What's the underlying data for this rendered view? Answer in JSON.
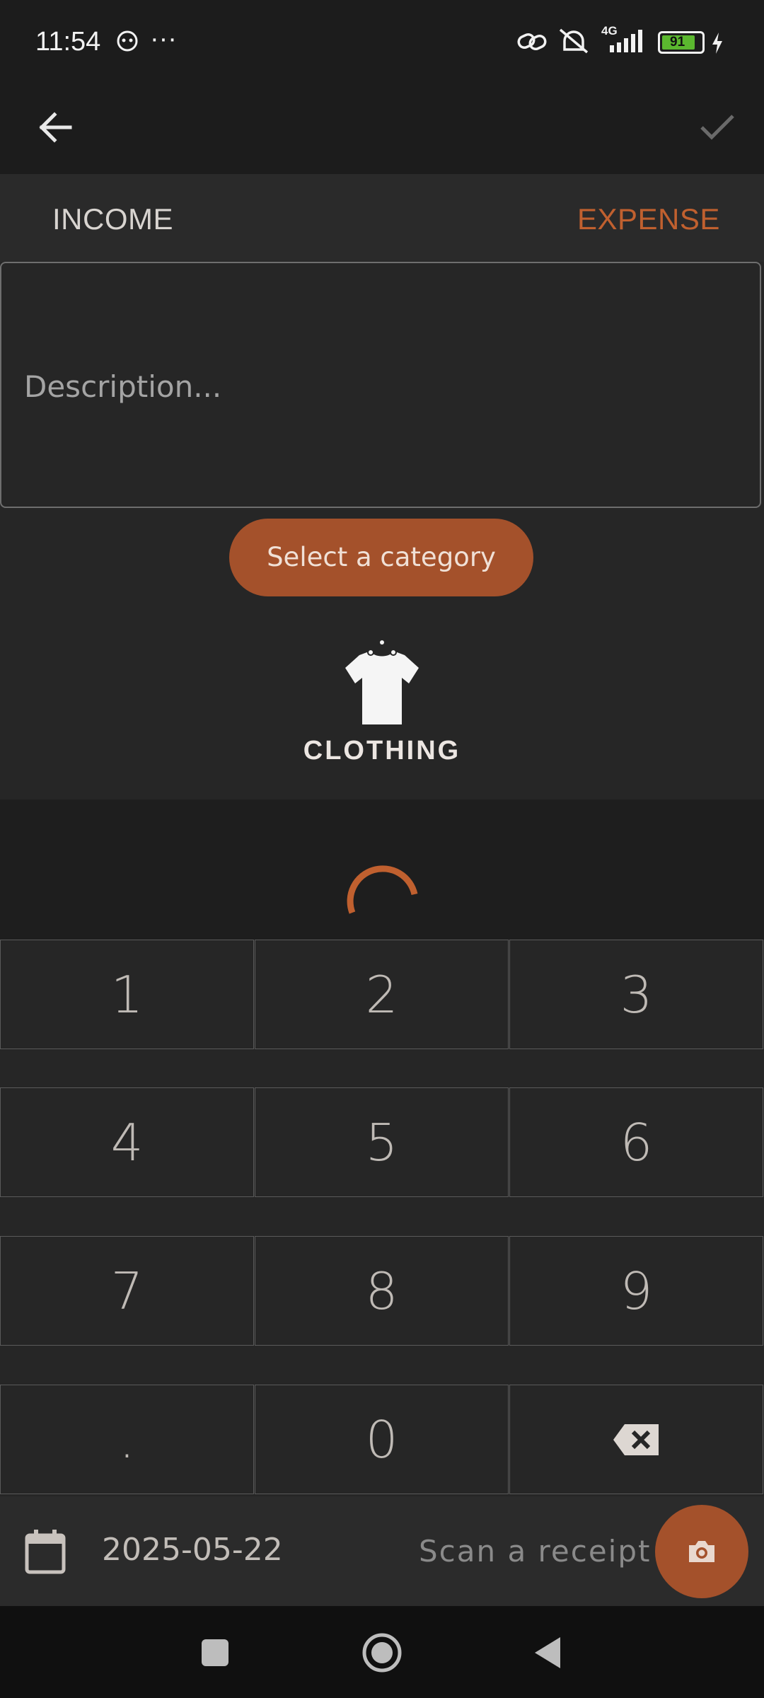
{
  "status_bar": {
    "time": "11:54",
    "dots": "···",
    "network": "4G",
    "battery": "91"
  },
  "app_bar": {
    "back_icon": "arrow-left-icon",
    "confirm_icon": "check-icon"
  },
  "tabs": [
    {
      "label": "INCOME",
      "active": false
    },
    {
      "label": "EXPENSE",
      "active": true
    }
  ],
  "description": {
    "placeholder": "Description..."
  },
  "category": {
    "button_label": "Select a category",
    "selected_icon": "shirt-icon",
    "selected_label": "CLOTHING"
  },
  "keypad": {
    "keys": [
      "1",
      "2",
      "3",
      "4",
      "5",
      "6",
      "7",
      "8",
      "9",
      ".",
      "0",
      "backspace"
    ]
  },
  "bottom_bar": {
    "date": "2025-05-22",
    "scan_label": "Scan a receipt",
    "calendar_icon": "calendar-icon",
    "camera_icon": "camera-icon"
  },
  "colors": {
    "accent": "#c0602f",
    "button": "#a4512b",
    "background": "#262626"
  }
}
